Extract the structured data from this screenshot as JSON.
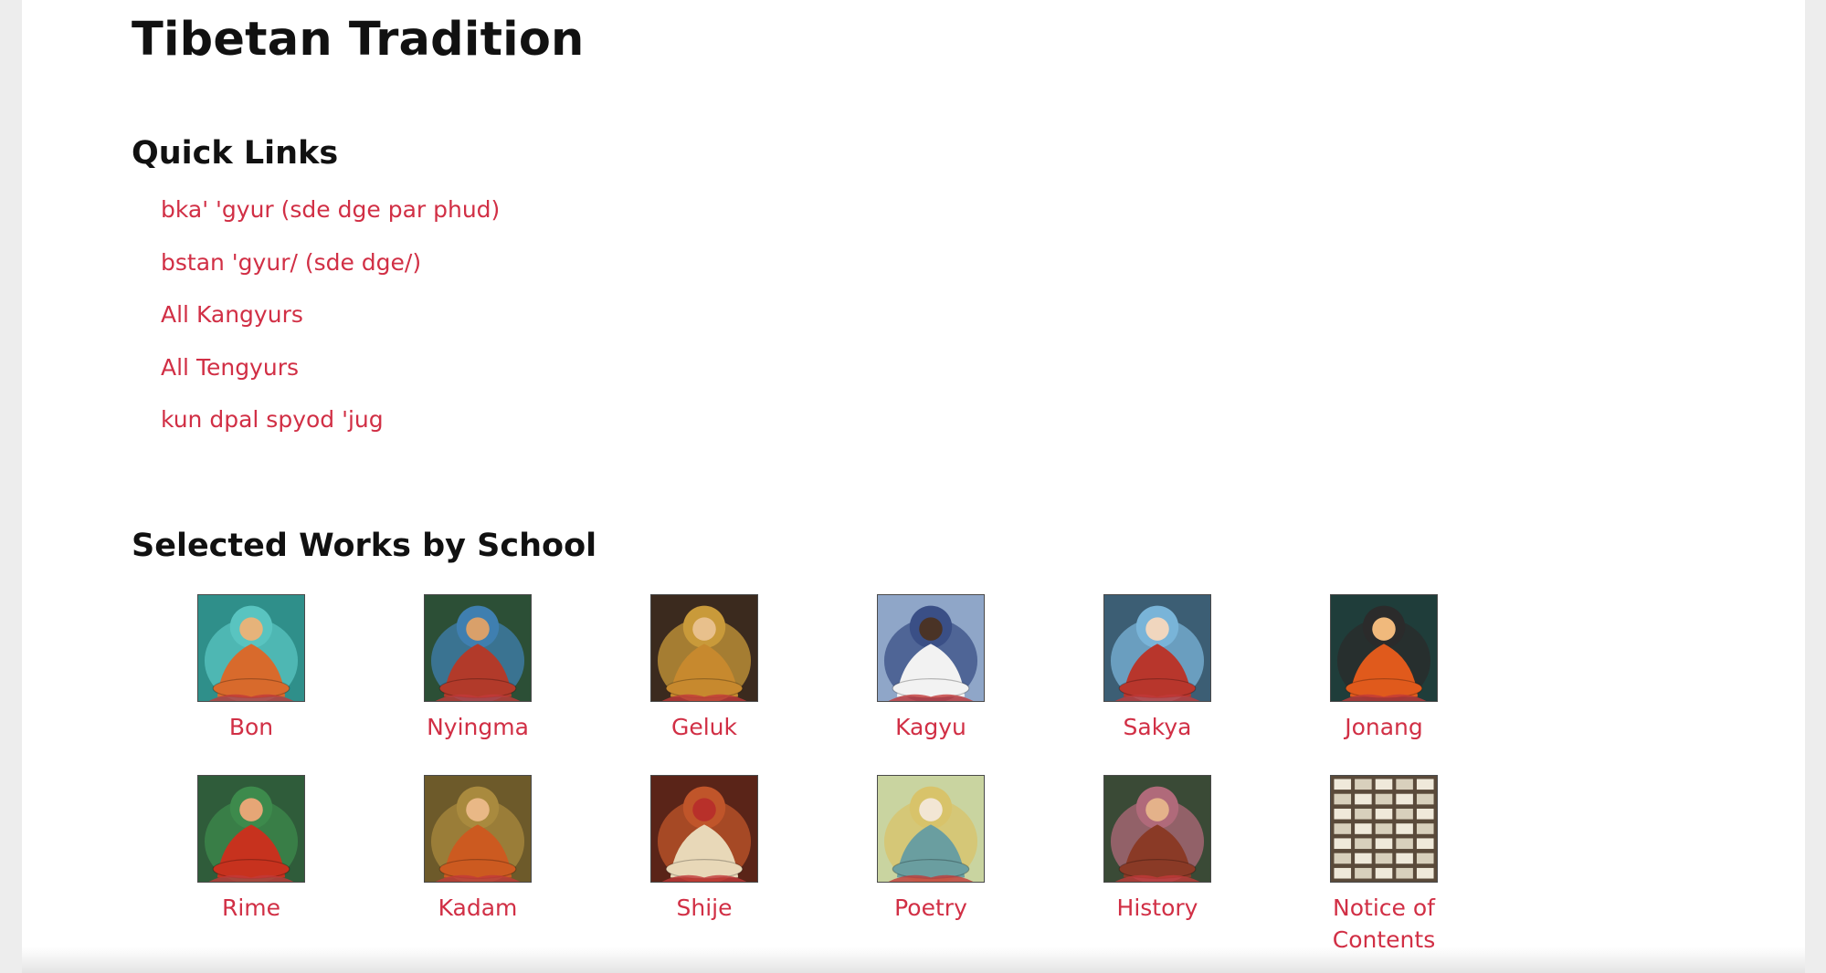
{
  "page": {
    "title": "Tibetan Tradition"
  },
  "quick_links": {
    "heading": "Quick Links",
    "items": [
      {
        "label": "bka' 'gyur (sde dge par phud)"
      },
      {
        "label": "bstan 'gyur/ (sde dge/)"
      },
      {
        "label": "All Kangyurs"
      },
      {
        "label": "All Tengyurs"
      },
      {
        "label": "kun dpal spyod 'jug"
      }
    ]
  },
  "schools": {
    "heading": "Selected Works by School",
    "items": [
      {
        "label": "Bon",
        "icon": "bon-thangka-icon",
        "bg": "#2f8f8a",
        "halo": "#59c4c0",
        "robe": "#d86a2c",
        "face": "#e6b37a"
      },
      {
        "label": "Nyingma",
        "icon": "nyingma-thangka-icon",
        "bg": "#2c4f36",
        "halo": "#3f7fb0",
        "robe": "#b23a2a",
        "face": "#d9a06a"
      },
      {
        "label": "Geluk",
        "icon": "geluk-thangka-icon",
        "bg": "#3b2a1e",
        "halo": "#c99a3a",
        "robe": "#c7892e",
        "face": "#e8c08c"
      },
      {
        "label": "Kagyu",
        "icon": "kagyu-thangka-icon",
        "bg": "#8fa6c8",
        "halo": "#3a4f86",
        "robe": "#f2f2f2",
        "face": "#4a3326"
      },
      {
        "label": "Sakya",
        "icon": "sakya-thangka-icon",
        "bg": "#3c5e74",
        "halo": "#79b4d8",
        "robe": "#b8362c",
        "face": "#f0d6be"
      },
      {
        "label": "Jonang",
        "icon": "jonang-thangka-icon",
        "bg": "#1f3d3a",
        "halo": "#2b2b2b",
        "robe": "#e05a1c",
        "face": "#f0b97c"
      },
      {
        "label": "Rime",
        "icon": "rime-thangka-icon",
        "bg": "#2f5c3a",
        "halo": "#3d8a4c",
        "robe": "#c7321e",
        "face": "#e6a676"
      },
      {
        "label": "Kadam",
        "icon": "kadam-thangka-icon",
        "bg": "#6d5a2a",
        "halo": "#a98a3e",
        "robe": "#cc5a20",
        "face": "#e9b886"
      },
      {
        "label": "Shije",
        "icon": "shije-thangka-icon",
        "bg": "#5a2418",
        "halo": "#c0552a",
        "robe": "#e8d8b8",
        "face": "#b8302a"
      },
      {
        "label": "Poetry",
        "icon": "poetry-thangka-icon",
        "bg": "#c9d4a0",
        "halo": "#d8c36a",
        "robe": "#6a9ea0",
        "face": "#f2e6d4"
      },
      {
        "label": "History",
        "icon": "history-thangka-icon",
        "bg": "#3a4a36",
        "halo": "#b06a7a",
        "robe": "#8a3a26",
        "face": "#e4b28a"
      },
      {
        "label": "Notice of Contents",
        "icon": "library-shelves-icon",
        "bg": "#5a4a3a",
        "halo": "#d8d0bc",
        "robe": "#cfc6b0",
        "face": "#efe9da"
      }
    ]
  }
}
